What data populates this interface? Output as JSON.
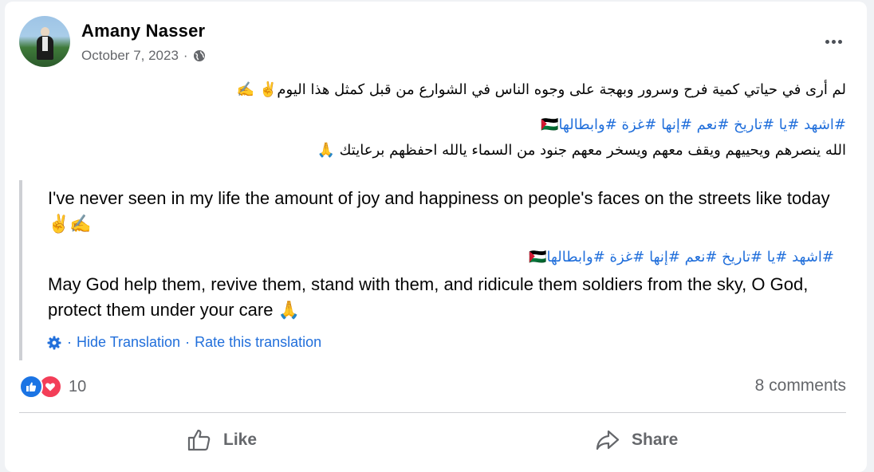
{
  "post": {
    "author": "Amany Nasser",
    "date": "October 7, 2023",
    "separator": "·",
    "privacy_icon": "globe-icon",
    "menu_icon": "more-horizontal-icon"
  },
  "original": {
    "line1": "لم أرى في حياتي كمية فرح وسرور وبهجة على وجوه الناس في الشوارع من قبل كمثل هذا اليوم✌️ ✍️",
    "hashtags": "#اشهد #يا #تاريخ #نعم #إنها #غزة #وابطالها🇵🇸",
    "line3": "الله ينصرهم ويحييهم ويقف معهم ويسخر معهم جنود من السماء يالله احفظهم برعايتك 🙏"
  },
  "translation": {
    "line1": "I've never seen in my life the amount of joy and happiness on people's faces on the streets like today✌️✍️",
    "hashtags": "#اشهد #يا #تاريخ #نعم #إنها #غزة #وابطالها🇵🇸",
    "line3": "May God help them, revive them, stand with them, and ridicule them soldiers from the sky, O God, protect them under your care 🙏",
    "hide_label": "Hide Translation",
    "rate_label": "Rate this translation",
    "dot": "·"
  },
  "reactions": {
    "count": "10",
    "types": [
      "like-icon",
      "love-icon"
    ],
    "comments": "8 comments"
  },
  "actions": {
    "like_label": "Like",
    "share_label": "Share"
  },
  "colors": {
    "link": "#216fdb",
    "muted": "#65676b",
    "like": "#1b74e4",
    "love": "#f33e58"
  }
}
